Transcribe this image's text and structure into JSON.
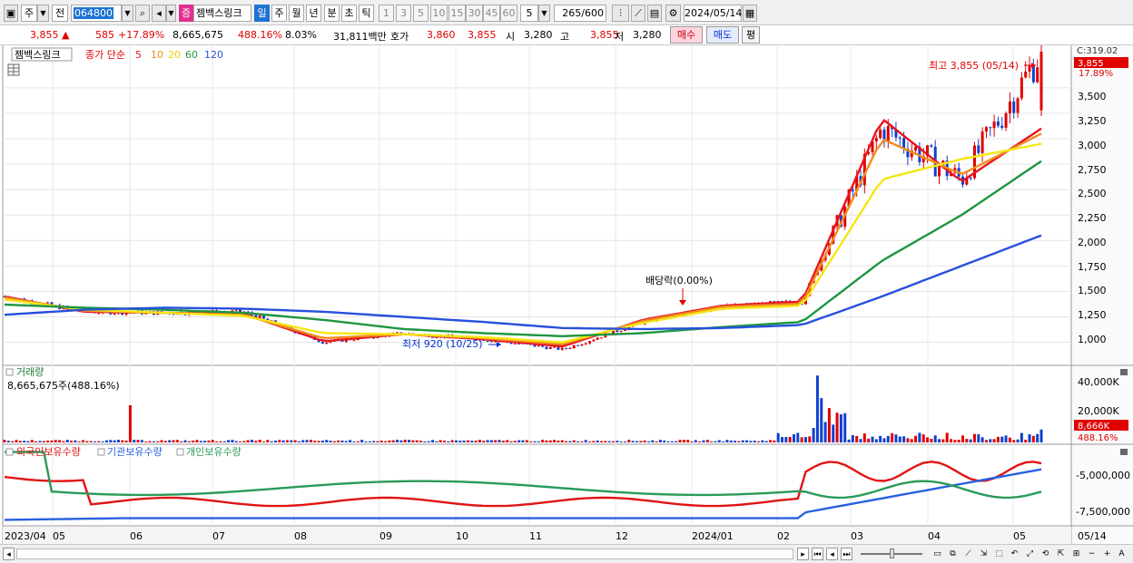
{
  "toolbar": {
    "market_btn": "주",
    "prev_btn": "전",
    "stock_code": "064800",
    "stock_name": "젬백스링크",
    "stock_tag": "증",
    "periods": [
      "일",
      "주",
      "월",
      "년",
      "분",
      "초",
      "틱"
    ],
    "active_period": "일",
    "intervals": [
      "1",
      "3",
      "5",
      "10",
      "15",
      "30",
      "45",
      "60"
    ],
    "interval_value": "5",
    "count_value": "265",
    "count_max": "/600",
    "date_value": "2024/05/14"
  },
  "info": {
    "price": "3,855",
    "change_arrow": "▲",
    "change": "585",
    "change_pct": "+17.89%",
    "volume": "8,665,675",
    "volume_pct": "488.16%",
    "turnover": "8.03%",
    "amount": "31,811백만",
    "quote_label": "호가",
    "ask": "3,860",
    "bid": "3,855",
    "open_label": "시",
    "open": "3,280",
    "high_label": "고",
    "high": "3,855",
    "low_label": "저",
    "low": "3,280",
    "buy_btn": "매수",
    "sell_btn": "매도",
    "eval_btn": "평"
  },
  "colors": {
    "up": "#e00000",
    "down": "#1040d0",
    "ma5": "#e8141e",
    "ma10": "#f08c1e",
    "ma20": "#f5e614",
    "ma60": "#1e9640",
    "ma120": "#2850dc",
    "foreign": "#e01414",
    "institution": "#2860e0",
    "individual": "#2a9a5a"
  },
  "price_panel": {
    "stock_label": "젬백스링크",
    "legend_prefix": "종가 단순",
    "ma_periods": [
      "5",
      "10",
      "20",
      "60",
      "120"
    ],
    "top_label": "C:319.02",
    "current_price_tag": "3,855",
    "current_pct_tag": "17.89%",
    "high_note": "최고 3,855 (05/14)",
    "low_note": "최저 920 (10/25)",
    "dividend_note": "배당락(0.00%)",
    "y_ticks": [
      "3,500",
      "3,250",
      "3,000",
      "2,750",
      "2,500",
      "2,250",
      "2,000",
      "1,750",
      "1,500",
      "1,250",
      "1,000"
    ]
  },
  "volume_panel": {
    "title": "거래량",
    "value_text": "8,665,675주(488.16%)",
    "y_ticks": [
      "40,000K",
      "20,000K"
    ],
    "current_tag": "8,666K",
    "pct_tag": "488.16%"
  },
  "holding_panel": {
    "legend": [
      "외국인보유수량",
      "기관보유수량",
      "개인보유수량"
    ],
    "y_ticks": [
      "-5,000,000",
      "-7,500,000"
    ]
  },
  "x_axis": {
    "labels": [
      "2023/04",
      "05",
      "06",
      "07",
      "08",
      "09",
      "10",
      "11",
      "12",
      "2024/01",
      "02",
      "03",
      "04",
      "05"
    ],
    "end_label": "05/14"
  },
  "chart_data": {
    "type": "candlestick",
    "title": "젬백스링크",
    "x_range": [
      "2023/04",
      "2024/05/14"
    ],
    "ylim": [
      800,
      3900
    ],
    "y_ticks": [
      1000,
      1250,
      1500,
      1750,
      2000,
      2250,
      2500,
      2750,
      3000,
      3250,
      3500
    ],
    "close_by_month": {
      "categories": [
        "2023/04",
        "05",
        "06",
        "07",
        "08",
        "09",
        "10",
        "11",
        "12",
        "2024/01",
        "02",
        "03",
        "04",
        "05"
      ],
      "values": [
        1450,
        1300,
        1290,
        1300,
        1000,
        1090,
        1030,
        930,
        1200,
        1350,
        1400,
        3100,
        2600,
        3855
      ]
    },
    "series": [
      {
        "name": "5",
        "values": [
          1450,
          1300,
          1290,
          1280,
          1010,
          1080,
          1030,
          960,
          1220,
          1360,
          1400,
          3200,
          2580,
          3100
        ]
      },
      {
        "name": "10",
        "values": [
          1440,
          1310,
          1290,
          1270,
          1040,
          1080,
          1040,
          980,
          1210,
          1350,
          1380,
          3000,
          2650,
          3050
        ]
      },
      {
        "name": "20",
        "values": [
          1420,
          1320,
          1290,
          1260,
          1090,
          1080,
          1050,
          1000,
          1190,
          1330,
          1360,
          2600,
          2800,
          2950
        ]
      },
      {
        "name": "60",
        "values": [
          1370,
          1340,
          1320,
          1290,
          1220,
          1130,
          1090,
          1060,
          1090,
          1150,
          1200,
          1800,
          2250,
          2780
        ]
      },
      {
        "name": "120",
        "values": [
          1270,
          1320,
          1340,
          1330,
          1300,
          1250,
          1200,
          1140,
          1130,
          1140,
          1170,
          1450,
          1750,
          2050
        ]
      }
    ],
    "annotations": [
      {
        "text": "최고 3,855 (05/14)",
        "x": "2024/05/14",
        "y": 3855
      },
      {
        "text": "최저 920 (10/25)",
        "x": "2023/10/25",
        "y": 920
      },
      {
        "text": "배당락(0.00%)",
        "x": "2023/12/27",
        "y": 1380
      }
    ],
    "volume": {
      "unit": "K",
      "ylim": [
        0,
        50000
      ],
      "y_ticks": [
        20000,
        40000
      ],
      "latest": 8666
    },
    "holdings": {
      "ylim": [
        -9000000,
        -3500000
      ],
      "y_ticks": [
        -5000000,
        -7500000
      ],
      "series": [
        "외국인보유수량",
        "기관보유수량",
        "개인보유수량"
      ]
    }
  }
}
